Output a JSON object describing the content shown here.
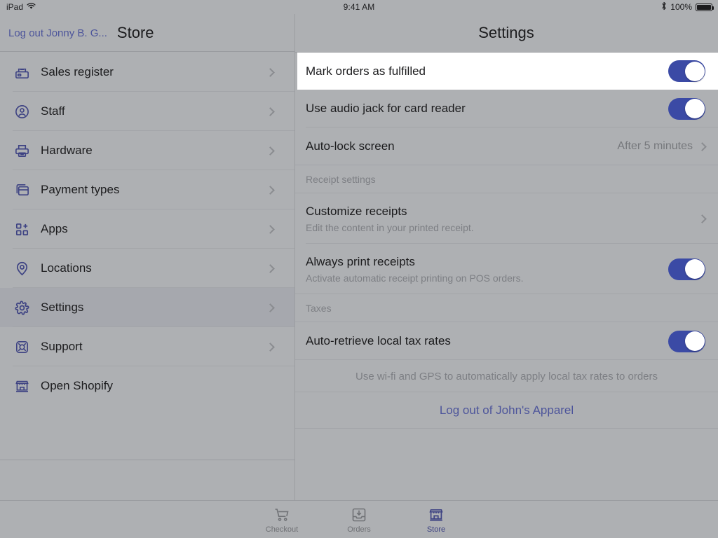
{
  "status_bar": {
    "device": "iPad",
    "wifi_icon": "wifi-icon",
    "time": "9:41 AM",
    "bluetooth_icon": "bluetooth-icon",
    "battery_percent": "100%",
    "battery_icon": "battery-full-icon"
  },
  "left_header": {
    "logout_label": "Log out Jonny B. G...",
    "title": "Store"
  },
  "right_header": {
    "title": "Settings"
  },
  "sidebar": {
    "items": [
      {
        "label": "Sales register",
        "icon": "cash-register-icon",
        "selected": false,
        "chevron": true
      },
      {
        "label": "Staff",
        "icon": "user-circle-icon",
        "selected": false,
        "chevron": true
      },
      {
        "label": "Hardware",
        "icon": "printer-icon",
        "selected": false,
        "chevron": true
      },
      {
        "label": "Payment types",
        "icon": "payment-card-icon",
        "selected": false,
        "chevron": true
      },
      {
        "label": "Apps",
        "icon": "apps-grid-plus-icon",
        "selected": false,
        "chevron": true
      },
      {
        "label": "Locations",
        "icon": "map-pin-icon",
        "selected": false,
        "chevron": true
      },
      {
        "label": "Settings",
        "icon": "gear-icon",
        "selected": true,
        "chevron": true
      },
      {
        "label": "Support",
        "icon": "lifebuoy-icon",
        "selected": false,
        "chevron": true
      },
      {
        "label": "Open Shopify",
        "icon": "storefront-icon",
        "selected": false,
        "chevron": false
      }
    ]
  },
  "settings": {
    "rows": {
      "mark_orders": {
        "title": "Mark orders as fulfilled",
        "toggle": "on",
        "highlighted": true
      },
      "audio_jack": {
        "title": "Use audio jack for card reader",
        "toggle": "on"
      },
      "auto_lock": {
        "title": "Auto-lock screen",
        "value": "After 5 minutes"
      }
    },
    "receipt_section": {
      "header": "Receipt settings",
      "customize": {
        "title": "Customize receipts",
        "subtitle": "Edit the content in your printed receipt."
      },
      "always_print": {
        "title": "Always print receipts",
        "subtitle": "Activate automatic receipt printing on POS orders.",
        "toggle": "on"
      }
    },
    "taxes_section": {
      "header": "Taxes",
      "auto_retrieve": {
        "title": "Auto-retrieve local tax rates",
        "toggle": "on"
      },
      "footnote": "Use wi-fi and GPS to automatically apply local tax rates to orders"
    },
    "logout_store": "Log out of John's Apparel"
  },
  "tab_bar": {
    "tabs": [
      {
        "label": "Checkout",
        "icon": "shopping-cart-icon",
        "active": false
      },
      {
        "label": "Orders",
        "icon": "inbox-download-icon",
        "active": false
      },
      {
        "label": "Store",
        "icon": "storefront-icon",
        "active": true
      }
    ]
  },
  "colors": {
    "accent_indigo": "#3e4383",
    "toggle_on": "#3b4aa5",
    "link": "#4d559b",
    "background": "#aeb0b3",
    "selected_row": "#a6a8ae",
    "highlight_row": "#ffffff",
    "muted_text": "#7d7f84"
  }
}
